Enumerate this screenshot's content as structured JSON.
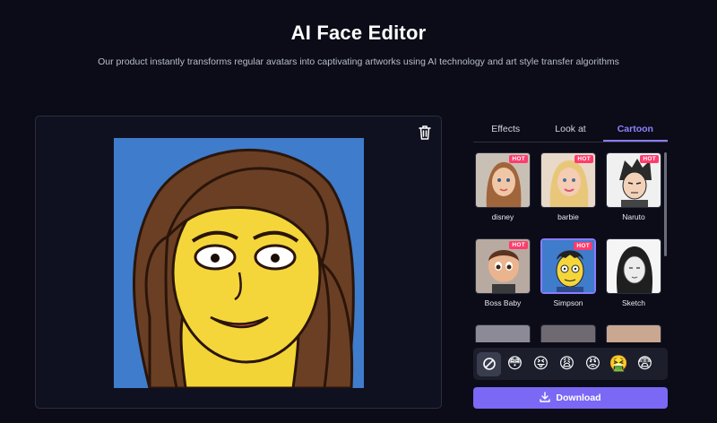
{
  "header": {
    "title": "AI Face Editor",
    "subtitle": "Our product instantly transforms regular avatars into captivating artworks using AI technology and art style transfer algorithms"
  },
  "tabs": [
    {
      "label": "Effects",
      "active": false
    },
    {
      "label": "Look at",
      "active": false
    },
    {
      "label": "Cartoon",
      "active": true
    }
  ],
  "styles": [
    {
      "label": "disney",
      "hot": "HOT"
    },
    {
      "label": "barbie",
      "hot": "HOT"
    },
    {
      "label": "Naruto",
      "hot": "HOT"
    },
    {
      "label": "Boss Baby",
      "hot": "HOT"
    },
    {
      "label": "Simpson",
      "hot": "HOT",
      "selected": true
    },
    {
      "label": "Sketch"
    }
  ],
  "expressions": {
    "none_icon": "no-expression-icon",
    "emojis": [
      "😳",
      "😝",
      "😩",
      "😡",
      "🤮",
      "😨"
    ]
  },
  "download_label": "Download",
  "colors": {
    "accent": "#7b68f5",
    "hot_badge": "#ff3c6e",
    "background": "#0b0c17"
  }
}
